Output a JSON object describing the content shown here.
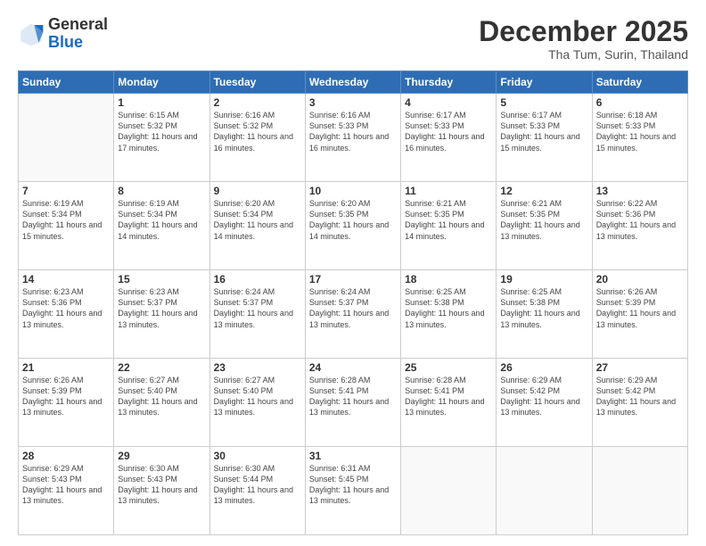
{
  "logo": {
    "general": "General",
    "blue": "Blue"
  },
  "header": {
    "month_title": "December 2025",
    "location": "Tha Tum, Surin, Thailand"
  },
  "weekdays": [
    "Sunday",
    "Monday",
    "Tuesday",
    "Wednesday",
    "Thursday",
    "Friday",
    "Saturday"
  ],
  "weeks": [
    [
      {
        "day": "",
        "sunrise": "",
        "sunset": "",
        "daylight": ""
      },
      {
        "day": "1",
        "sunrise": "Sunrise: 6:15 AM",
        "sunset": "Sunset: 5:32 PM",
        "daylight": "Daylight: 11 hours and 17 minutes."
      },
      {
        "day": "2",
        "sunrise": "Sunrise: 6:16 AM",
        "sunset": "Sunset: 5:32 PM",
        "daylight": "Daylight: 11 hours and 16 minutes."
      },
      {
        "day": "3",
        "sunrise": "Sunrise: 6:16 AM",
        "sunset": "Sunset: 5:33 PM",
        "daylight": "Daylight: 11 hours and 16 minutes."
      },
      {
        "day": "4",
        "sunrise": "Sunrise: 6:17 AM",
        "sunset": "Sunset: 5:33 PM",
        "daylight": "Daylight: 11 hours and 16 minutes."
      },
      {
        "day": "5",
        "sunrise": "Sunrise: 6:17 AM",
        "sunset": "Sunset: 5:33 PM",
        "daylight": "Daylight: 11 hours and 15 minutes."
      },
      {
        "day": "6",
        "sunrise": "Sunrise: 6:18 AM",
        "sunset": "Sunset: 5:33 PM",
        "daylight": "Daylight: 11 hours and 15 minutes."
      }
    ],
    [
      {
        "day": "7",
        "sunrise": "Sunrise: 6:19 AM",
        "sunset": "Sunset: 5:34 PM",
        "daylight": "Daylight: 11 hours and 15 minutes."
      },
      {
        "day": "8",
        "sunrise": "Sunrise: 6:19 AM",
        "sunset": "Sunset: 5:34 PM",
        "daylight": "Daylight: 11 hours and 14 minutes."
      },
      {
        "day": "9",
        "sunrise": "Sunrise: 6:20 AM",
        "sunset": "Sunset: 5:34 PM",
        "daylight": "Daylight: 11 hours and 14 minutes."
      },
      {
        "day": "10",
        "sunrise": "Sunrise: 6:20 AM",
        "sunset": "Sunset: 5:35 PM",
        "daylight": "Daylight: 11 hours and 14 minutes."
      },
      {
        "day": "11",
        "sunrise": "Sunrise: 6:21 AM",
        "sunset": "Sunset: 5:35 PM",
        "daylight": "Daylight: 11 hours and 14 minutes."
      },
      {
        "day": "12",
        "sunrise": "Sunrise: 6:21 AM",
        "sunset": "Sunset: 5:35 PM",
        "daylight": "Daylight: 11 hours and 13 minutes."
      },
      {
        "day": "13",
        "sunrise": "Sunrise: 6:22 AM",
        "sunset": "Sunset: 5:36 PM",
        "daylight": "Daylight: 11 hours and 13 minutes."
      }
    ],
    [
      {
        "day": "14",
        "sunrise": "Sunrise: 6:23 AM",
        "sunset": "Sunset: 5:36 PM",
        "daylight": "Daylight: 11 hours and 13 minutes."
      },
      {
        "day": "15",
        "sunrise": "Sunrise: 6:23 AM",
        "sunset": "Sunset: 5:37 PM",
        "daylight": "Daylight: 11 hours and 13 minutes."
      },
      {
        "day": "16",
        "sunrise": "Sunrise: 6:24 AM",
        "sunset": "Sunset: 5:37 PM",
        "daylight": "Daylight: 11 hours and 13 minutes."
      },
      {
        "day": "17",
        "sunrise": "Sunrise: 6:24 AM",
        "sunset": "Sunset: 5:37 PM",
        "daylight": "Daylight: 11 hours and 13 minutes."
      },
      {
        "day": "18",
        "sunrise": "Sunrise: 6:25 AM",
        "sunset": "Sunset: 5:38 PM",
        "daylight": "Daylight: 11 hours and 13 minutes."
      },
      {
        "day": "19",
        "sunrise": "Sunrise: 6:25 AM",
        "sunset": "Sunset: 5:38 PM",
        "daylight": "Daylight: 11 hours and 13 minutes."
      },
      {
        "day": "20",
        "sunrise": "Sunrise: 6:26 AM",
        "sunset": "Sunset: 5:39 PM",
        "daylight": "Daylight: 11 hours and 13 minutes."
      }
    ],
    [
      {
        "day": "21",
        "sunrise": "Sunrise: 6:26 AM",
        "sunset": "Sunset: 5:39 PM",
        "daylight": "Daylight: 11 hours and 13 minutes."
      },
      {
        "day": "22",
        "sunrise": "Sunrise: 6:27 AM",
        "sunset": "Sunset: 5:40 PM",
        "daylight": "Daylight: 11 hours and 13 minutes."
      },
      {
        "day": "23",
        "sunrise": "Sunrise: 6:27 AM",
        "sunset": "Sunset: 5:40 PM",
        "daylight": "Daylight: 11 hours and 13 minutes."
      },
      {
        "day": "24",
        "sunrise": "Sunrise: 6:28 AM",
        "sunset": "Sunset: 5:41 PM",
        "daylight": "Daylight: 11 hours and 13 minutes."
      },
      {
        "day": "25",
        "sunrise": "Sunrise: 6:28 AM",
        "sunset": "Sunset: 5:41 PM",
        "daylight": "Daylight: 11 hours and 13 minutes."
      },
      {
        "day": "26",
        "sunrise": "Sunrise: 6:29 AM",
        "sunset": "Sunset: 5:42 PM",
        "daylight": "Daylight: 11 hours and 13 minutes."
      },
      {
        "day": "27",
        "sunrise": "Sunrise: 6:29 AM",
        "sunset": "Sunset: 5:42 PM",
        "daylight": "Daylight: 11 hours and 13 minutes."
      }
    ],
    [
      {
        "day": "28",
        "sunrise": "Sunrise: 6:29 AM",
        "sunset": "Sunset: 5:43 PM",
        "daylight": "Daylight: 11 hours and 13 minutes."
      },
      {
        "day": "29",
        "sunrise": "Sunrise: 6:30 AM",
        "sunset": "Sunset: 5:43 PM",
        "daylight": "Daylight: 11 hours and 13 minutes."
      },
      {
        "day": "30",
        "sunrise": "Sunrise: 6:30 AM",
        "sunset": "Sunset: 5:44 PM",
        "daylight": "Daylight: 11 hours and 13 minutes."
      },
      {
        "day": "31",
        "sunrise": "Sunrise: 6:31 AM",
        "sunset": "Sunset: 5:45 PM",
        "daylight": "Daylight: 11 hours and 13 minutes."
      },
      {
        "day": "",
        "sunrise": "",
        "sunset": "",
        "daylight": ""
      },
      {
        "day": "",
        "sunrise": "",
        "sunset": "",
        "daylight": ""
      },
      {
        "day": "",
        "sunrise": "",
        "sunset": "",
        "daylight": ""
      }
    ]
  ]
}
